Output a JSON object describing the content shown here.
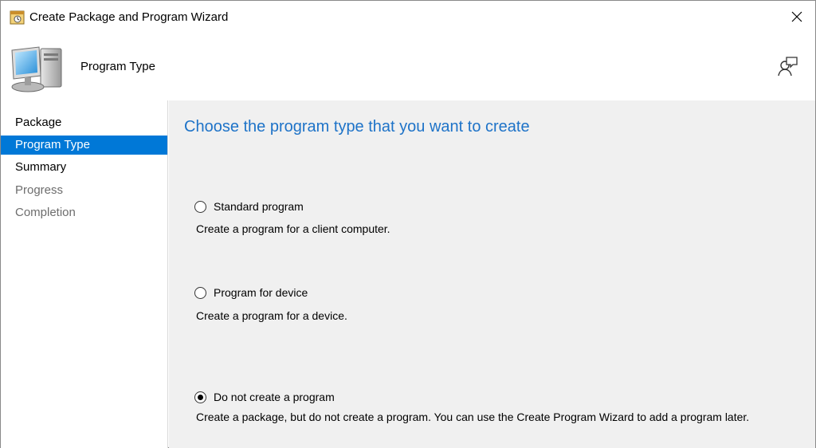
{
  "window": {
    "title": "Create Package and Program Wizard"
  },
  "header": {
    "page_title": "Program Type"
  },
  "nav": {
    "items": [
      {
        "label": "Package",
        "state": "done"
      },
      {
        "label": "Program Type",
        "state": "active"
      },
      {
        "label": "Summary",
        "state": "done"
      },
      {
        "label": "Progress",
        "state": "future"
      },
      {
        "label": "Completion",
        "state": "future"
      }
    ]
  },
  "main": {
    "heading": "Choose the program type that you want to create",
    "options": [
      {
        "label": "Standard program",
        "description": "Create a program for a client computer.",
        "checked": false
      },
      {
        "label": "Program for device",
        "description": "Create a program for a device.",
        "checked": false
      },
      {
        "label": "Do not create a program",
        "description": "Create a package, but do not create a program. You can use the Create Program Wizard to add a program later.",
        "checked": true
      }
    ]
  },
  "colors": {
    "accent": "#0078d7",
    "heading": "#1e73c8",
    "content_bg": "#f0f0f0"
  },
  "icons": {
    "title": "wizard-app-icon",
    "close": "close-icon",
    "header": "computer-icon",
    "help": "feedback-icon"
  }
}
